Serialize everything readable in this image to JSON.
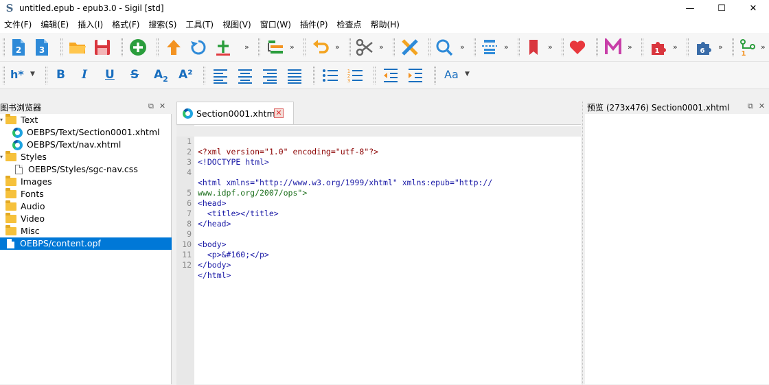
{
  "window": {
    "title": "untitled.epub - epub3.0 - Sigil [std]",
    "app_icon": "S",
    "minimize": "—",
    "maximize": "☐",
    "close": "✕"
  },
  "menu": [
    "文件(F)",
    "编辑(E)",
    "插入(I)",
    "格式(F)",
    "搜索(S)",
    "工具(T)",
    "视图(V)",
    "窗口(W)",
    "插件(P)",
    "检查点",
    "帮助(H)"
  ],
  "toolbar2": {
    "heading": "h*",
    "bold": "B",
    "italic": "I",
    "underline": "U",
    "strike": "S",
    "subscript": "A",
    "subscript_sub": "2",
    "superscript": "A²",
    "case": "Aa",
    "chevrons": "»"
  },
  "book_browser": {
    "title": "图书浏览器",
    "items": [
      {
        "label": "Text",
        "type": "folder",
        "caret": "▾"
      },
      {
        "label": "OEBPS/Text/Section0001.xhtml",
        "type": "edge"
      },
      {
        "label": "OEBPS/Text/nav.xhtml",
        "type": "edge"
      },
      {
        "label": "Styles",
        "type": "folder",
        "caret": "▾"
      },
      {
        "label": "OEBPS/Styles/sgc-nav.css",
        "type": "file"
      },
      {
        "label": "Images",
        "type": "folder"
      },
      {
        "label": "Fonts",
        "type": "folder"
      },
      {
        "label": "Audio",
        "type": "folder"
      },
      {
        "label": "Video",
        "type": "folder"
      },
      {
        "label": "Misc",
        "type": "folder"
      },
      {
        "label": "OEBPS/content.opf",
        "type": "file",
        "selected": true
      }
    ]
  },
  "editor": {
    "tab_label": "Section0001.xhtml",
    "lines": [
      {
        "n": "1",
        "text": "<?xml version=\"1.0\" encoding=\"utf-8\"?>"
      },
      {
        "n": "2",
        "text": "<!DOCTYPE html>"
      },
      {
        "n": "3",
        "text": ""
      },
      {
        "n": "4",
        "text": "<html xmlns=\"http://www.w3.org/1999/xhtml\" xmlns:epub=\"http://"
      },
      {
        "n": "",
        "text": "www.idpf.org/2007/ops\">"
      },
      {
        "n": "5",
        "text": "<head>"
      },
      {
        "n": "6",
        "text": "  <title></title>"
      },
      {
        "n": "7",
        "text": "</head>"
      },
      {
        "n": "8",
        "text": ""
      },
      {
        "n": "9",
        "text": "<body>"
      },
      {
        "n": "10",
        "text": "  <p>&#160;</p>"
      },
      {
        "n": "11",
        "text": "</body>"
      },
      {
        "n": "12",
        "text": "</html>"
      }
    ]
  },
  "preview": {
    "title": "预览 (273x476) Section0001.xhtml"
  },
  "panel_buttons": {
    "float": "⧉",
    "close": "✕"
  }
}
